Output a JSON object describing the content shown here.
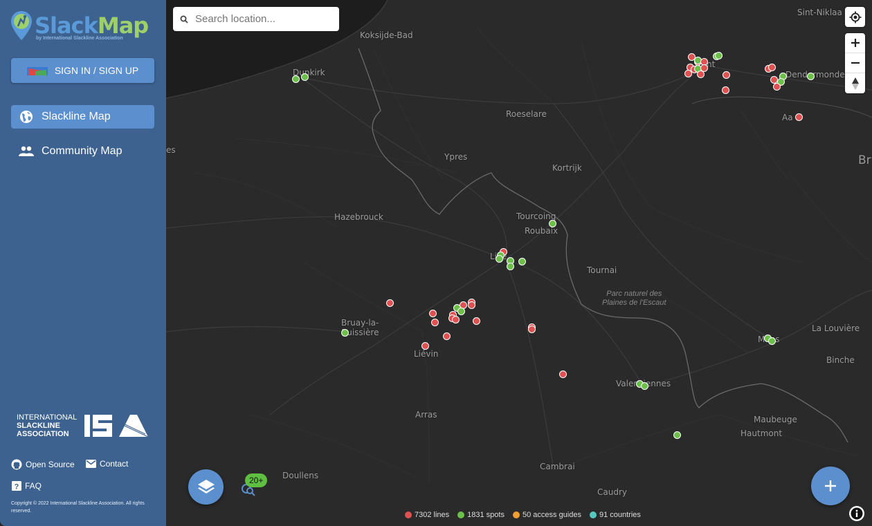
{
  "app": {
    "name_part1": "Slack",
    "name_part2": "Map",
    "subtitle": "by International Slackline Association"
  },
  "sidebar": {
    "signin_label": "SIGN IN / SIGN UP",
    "nav": [
      {
        "label": "Slackline Map",
        "icon": "globe-icon",
        "active": true
      },
      {
        "label": "Community Map",
        "icon": "people-icon",
        "active": false
      }
    ],
    "isa": {
      "line1": "INTERNATIONAL",
      "line2": "SLACKLINE",
      "line3": "ASSOCIATION"
    },
    "links": {
      "open_source": "Open Source",
      "contact": "Contact",
      "faq": "FAQ"
    },
    "copyright": "Copyright © 2022 International Slackline Association. All rights reserved."
  },
  "search": {
    "placeholder": "Search location..."
  },
  "map": {
    "towns": {
      "koksijde": "Koksijde-Bad",
      "dunkirk": "Dunkirk",
      "sint_niklaas": "Sint-Niklaa",
      "gent": "nt",
      "dendermonde": "Dendermonde",
      "roeselare": "Roeselare",
      "aalst": "Aa",
      "ypres": "Ypres",
      "kortrijk": "Kortrijk",
      "brussels": "Br",
      "hazebrouck": "Hazebrouck",
      "tourcoing": "Tourcoing",
      "roubaix": "Roubaix",
      "lille": "Lille",
      "tournai": "Tournai",
      "bruay1": "Bruay-la-",
      "bruay2": "Buissière",
      "lievin": "Liévin",
      "la_louviere": "La Louvière",
      "mons": "Mons",
      "binche": "Binche",
      "valenciennes": "Valenciennes",
      "arras": "Arras",
      "maubeuge": "Maubeuge",
      "hautmont": "Hautmont",
      "doullens": "Doullens",
      "cambrai": "Cambrai",
      "caudry": "Caudry",
      "left_edge": "es",
      "park": "Parc naturel des",
      "park2": "Plaines de l'Escaut"
    },
    "cluster_badge": "20+",
    "legend": [
      {
        "label": "7302 lines",
        "color": "#e05252"
      },
      {
        "label": "1831 spots",
        "color": "#6cc04a"
      },
      {
        "label": "50 access guides",
        "color": "#f0a030"
      },
      {
        "label": "91 countries",
        "color": "#55c8c0"
      }
    ]
  }
}
